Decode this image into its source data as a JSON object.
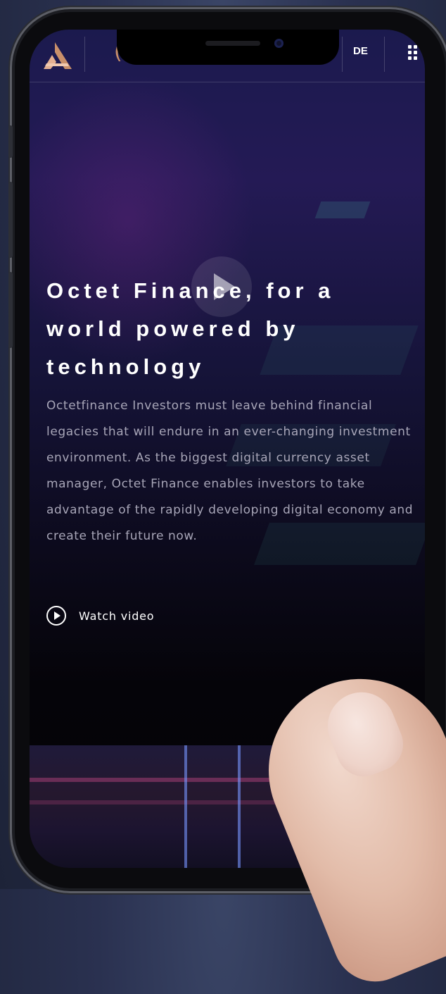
{
  "header": {
    "brand_partial": "(",
    "lang_label": "DE",
    "logo_icon": "octet-logo-icon",
    "menu_icon": "grid-menu-icon"
  },
  "hero": {
    "title": "Octet Finance, for a world powered by technology",
    "description": "Octetfinance Investors must leave behind financial legacies that will endure in an ever-changing investment environment. As the biggest digital currency asset manager, Octet Finance enables investors to take advantage of the rapidly developing digital economy and create their future now.",
    "watch_label": "Watch video",
    "play_icon": "play-icon",
    "watch_icon": "play-circle-icon"
  },
  "colors": {
    "accent_logo": "#c9906a",
    "text_primary": "#ffffff",
    "text_secondary": "#a8a6b8"
  }
}
